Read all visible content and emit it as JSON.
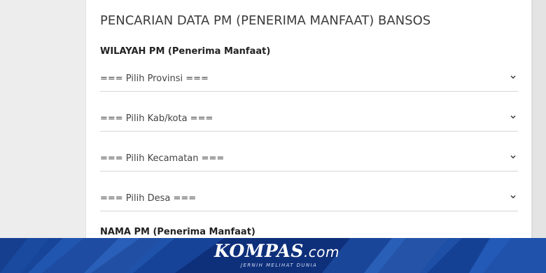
{
  "form": {
    "title": "PENCARIAN DATA PM (PENERIMA MANFAAT) BANSOS",
    "wilayah_label": "WILAYAH PM (Penerima Manfaat)",
    "selects": [
      {
        "value": "=== Pilih Provinsi ==="
      },
      {
        "value": "=== Pilih Kab/kota ==="
      },
      {
        "value": "=== Pilih Kecamatan ==="
      },
      {
        "value": "=== Pilih Desa ==="
      }
    ],
    "nama_label": "NAMA PM (Penerima Manfaat)"
  },
  "watermark": {
    "brand": "KOMPAS",
    "domain": ".com",
    "tagline": "JERNIH MELIHAT DUNIA"
  },
  "colors": {
    "banner": "#0e2f7a",
    "accent": "#2f6fd6"
  },
  "icons": {
    "select_arrow": "chevron-down-icon"
  }
}
